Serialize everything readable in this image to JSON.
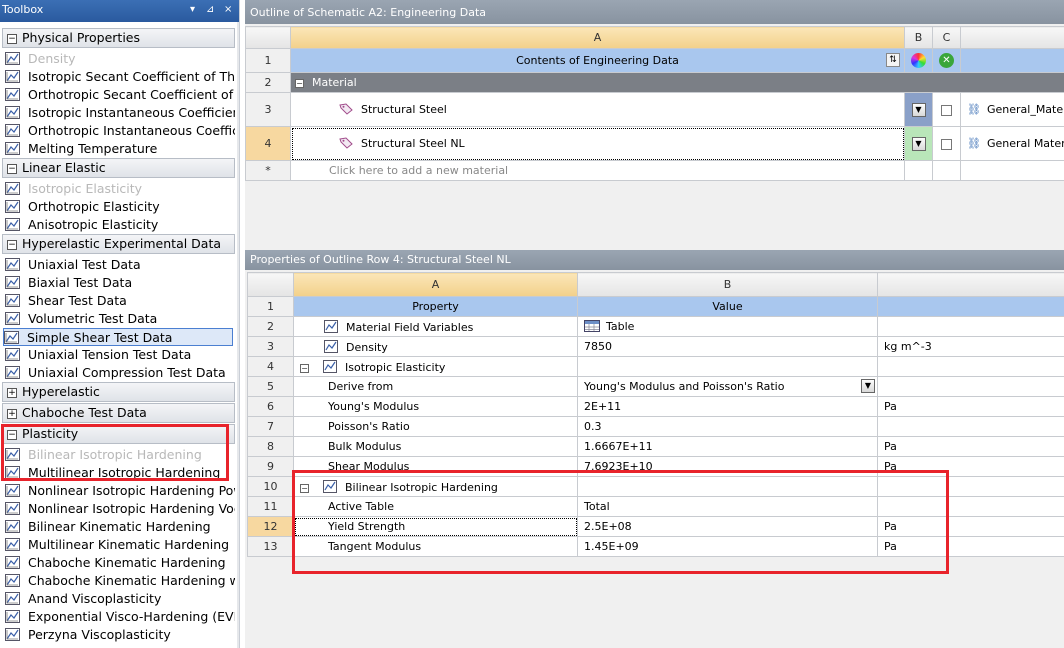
{
  "toolbox": {
    "title": "Toolbox",
    "controls": [
      "▾",
      "⊿",
      "×"
    ],
    "groups": [
      {
        "label": "Physical Properties",
        "state": "⊟",
        "items": [
          {
            "label": "Density",
            "disabled": true
          },
          {
            "label": "Isotropic Secant Coefficient of Thermal Expansion"
          },
          {
            "label": "Orthotropic Secant Coefficient of Thermal Expansion"
          },
          {
            "label": "Isotropic Instantaneous Coefficient of Thermal Expansion"
          },
          {
            "label": "Orthotropic Instantaneous Coefficient of Thermal Expansion"
          },
          {
            "label": "Melting Temperature"
          }
        ]
      },
      {
        "label": "Linear Elastic",
        "state": "⊟",
        "items": [
          {
            "label": "Isotropic Elasticity",
            "disabled": true
          },
          {
            "label": "Orthotropic Elasticity"
          },
          {
            "label": "Anisotropic Elasticity"
          }
        ]
      },
      {
        "label": "Hyperelastic Experimental Data",
        "state": "⊟",
        "items": [
          {
            "label": "Uniaxial Test Data"
          },
          {
            "label": "Biaxial Test Data"
          },
          {
            "label": "Shear Test Data"
          },
          {
            "label": "Volumetric Test Data"
          },
          {
            "label": "Simple Shear Test Data",
            "selected": true
          },
          {
            "label": "Uniaxial Tension Test Data"
          },
          {
            "label": "Uniaxial Compression Test Data"
          }
        ]
      },
      {
        "label": "Hyperelastic",
        "state": "⊞",
        "items": []
      },
      {
        "label": "Chaboche Test Data",
        "state": "⊞",
        "items": []
      },
      {
        "label": "Plasticity",
        "state": "⊟",
        "items": [
          {
            "label": "Bilinear Isotropic Hardening",
            "disabled": true
          },
          {
            "label": "Multilinear Isotropic Hardening"
          },
          {
            "label": "Nonlinear Isotropic Hardening Power Law"
          },
          {
            "label": "Nonlinear Isotropic Hardening Voce Law"
          },
          {
            "label": "Bilinear Kinematic Hardening"
          },
          {
            "label": "Multilinear Kinematic Hardening"
          },
          {
            "label": "Chaboche Kinematic Hardening"
          },
          {
            "label": "Chaboche Kinematic Hardening w/"
          },
          {
            "label": "Anand Viscoplasticity"
          },
          {
            "label": "Exponential Visco-Hardening (EVH)"
          },
          {
            "label": "Perzyna Viscoplasticity"
          }
        ]
      }
    ]
  },
  "outline": {
    "title": "Outline of Schematic A2: Engineering Data",
    "columns": [
      "A",
      "B",
      "C"
    ],
    "header_row": {
      "num": "1",
      "label": "Contents of Engineering Data"
    },
    "group_row": {
      "num": "2",
      "label": "Material"
    },
    "rows": [
      {
        "num": "3",
        "name": "Structural Steel",
        "source": "General_Materials.xml"
      },
      {
        "num": "4",
        "name": "Structural Steel NL",
        "source": "General Materials.xml"
      }
    ],
    "add_row": {
      "num": "*",
      "label": "Click here to add a new material"
    }
  },
  "properties": {
    "title": "Properties of Outline Row 4: Structural Steel NL",
    "columns": [
      "A",
      "B"
    ],
    "header": {
      "num": "1",
      "property": "Property",
      "value": "Value"
    },
    "rows": [
      {
        "num": "2",
        "property": "Material Field Variables",
        "value": "Table",
        "unit": "",
        "icon": "table-icon"
      },
      {
        "num": "3",
        "property": "Density",
        "value": "7850",
        "unit": "kg m^-3"
      },
      {
        "num": "4",
        "property": "Isotropic Elasticity",
        "value": "",
        "unit": "",
        "group": true
      },
      {
        "num": "5",
        "property": "Derive from",
        "value": "Young's Modulus and Poisson's Ratio",
        "unit": "",
        "dropdown": true
      },
      {
        "num": "6",
        "property": "Young's Modulus",
        "value": "2E+11",
        "unit": "Pa"
      },
      {
        "num": "7",
        "property": "Poisson's Ratio",
        "value": "0.3",
        "unit": ""
      },
      {
        "num": "8",
        "property": "Bulk Modulus",
        "value": "1.6667E+11",
        "unit": "Pa"
      },
      {
        "num": "9",
        "property": "Shear Modulus",
        "value": "7.6923E+10",
        "unit": "Pa"
      },
      {
        "num": "10",
        "property": "Bilinear Isotropic Hardening",
        "value": "",
        "unit": "",
        "group": true
      },
      {
        "num": "11",
        "property": "Active Table",
        "value": "Total",
        "unit": ""
      },
      {
        "num": "12",
        "property": "Yield Strength",
        "value": "2.5E+08",
        "unit": "Pa",
        "selected": true
      },
      {
        "num": "13",
        "property": "Tangent Modulus",
        "value": "1.45E+09",
        "unit": "Pa"
      }
    ]
  }
}
